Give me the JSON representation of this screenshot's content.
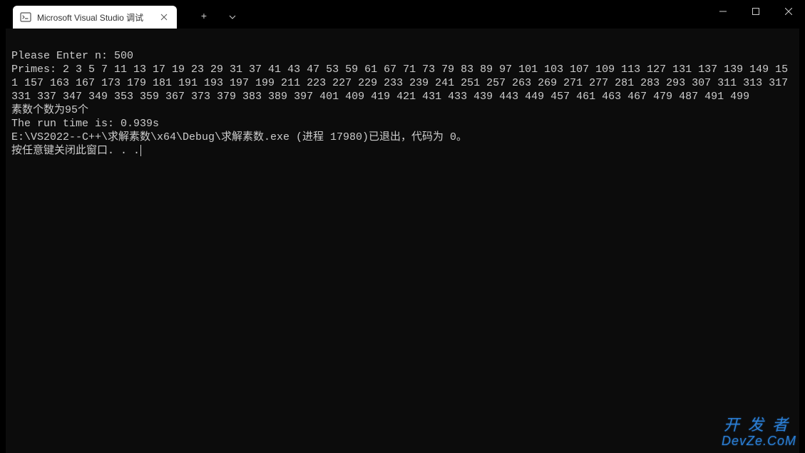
{
  "titlebar": {
    "tab_title": "Microsoft Visual Studio 调试",
    "new_tab_label": "+",
    "dropdown_label": "⌄"
  },
  "console": {
    "line1": "Please Enter n: 500",
    "line2": "Primes: 2 3 5 7 11 13 17 19 23 29 31 37 41 43 47 53 59 61 67 71 73 79 83 89 97 101 103 107 109 113 127 131 137 139 149 151 157 163 167 173 179 181 191 193 197 199 211 223 227 229 233 239 241 251 257 263 269 271 277 281 283 293 307 311 313 317 331 337 347 349 353 359 367 373 379 383 389 397 401 409 419 421 431 433 439 443 449 457 461 463 467 479 487 491 499",
    "line3": "素数个数为95个",
    "line4": "The run time is: 0.939s",
    "blank": "",
    "line6": "E:\\VS2022--C++\\求解素数\\x64\\Debug\\求解素数.exe (进程 17980)已退出，代码为 0。",
    "line7": "按任意键关闭此窗口. . ."
  },
  "watermark": {
    "line1": "开发者",
    "line2": "DevZe.CoM"
  }
}
